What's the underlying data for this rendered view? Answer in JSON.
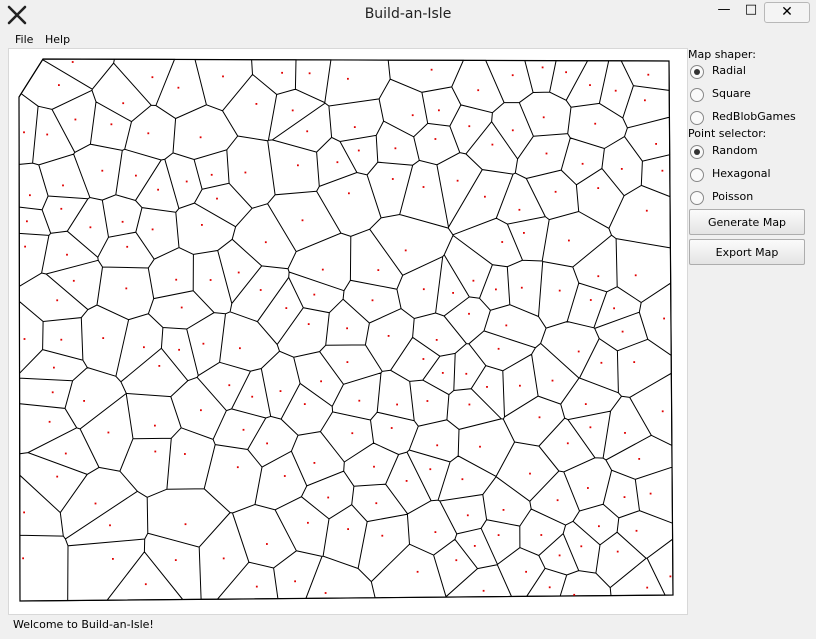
{
  "window": {
    "title": "Build-an-Isle",
    "app_icon": "x-logo-icon"
  },
  "menu": {
    "file": "File",
    "help": "Help"
  },
  "panel": {
    "map_shaper_label": "Map shaper:",
    "map_shapers": [
      {
        "label": "Radial",
        "selected": true
      },
      {
        "label": "Square",
        "selected": false
      },
      {
        "label": "RedBlobGames",
        "selected": false
      }
    ],
    "point_selector_label": "Point selector:",
    "point_selectors": [
      {
        "label": "Random",
        "selected": true
      },
      {
        "label": "Hexagonal",
        "selected": false
      },
      {
        "label": "Poisson",
        "selected": false
      }
    ],
    "generate_button": "Generate Map",
    "export_button": "Export Map"
  },
  "status": "Welcome to Build-an-Isle!",
  "colors": {
    "site_point": "#e00000",
    "cell_edge": "#000000"
  }
}
